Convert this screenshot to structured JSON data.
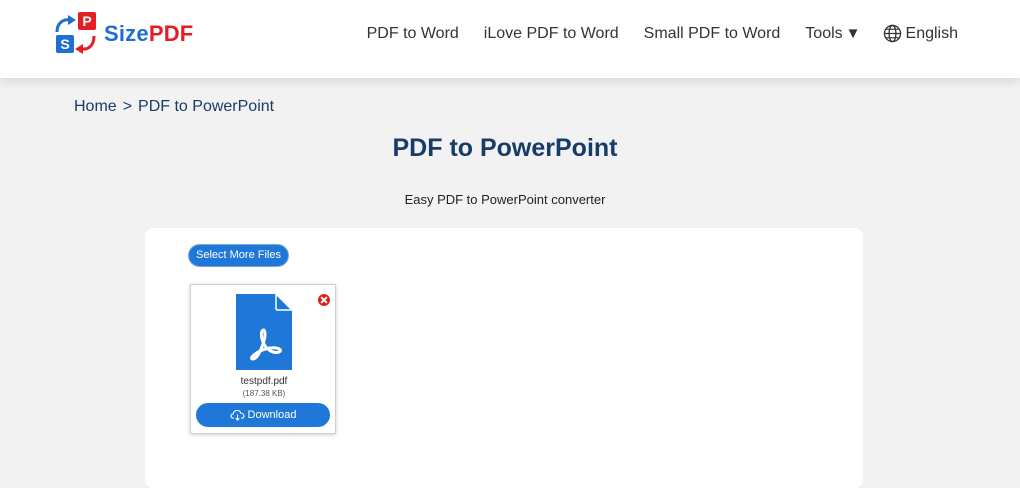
{
  "brand": {
    "name_part1": "Size",
    "name_part2": "PDF",
    "colors": {
      "blue": "#1f6fd1",
      "red": "#e31f26"
    },
    "logo_letters": {
      "top": "P",
      "bottom": "S"
    }
  },
  "nav": {
    "items": [
      {
        "label": "PDF to Word"
      },
      {
        "label": "iLove PDF to Word"
      },
      {
        "label": "Small PDF to Word"
      }
    ],
    "tools_label": "Tools",
    "tools_caret": "▼",
    "language_label": "English",
    "language_icon": "globe-icon"
  },
  "breadcrumb": {
    "home": "Home",
    "separator": ">",
    "current": "PDF to PowerPoint"
  },
  "page": {
    "title": "PDF to PowerPoint",
    "subtitle": "Easy PDF to PowerPoint converter"
  },
  "upload": {
    "select_more_label": "Select More Files",
    "files": [
      {
        "name": "testpdf.pdf",
        "size": "(187.38 KB)",
        "icon": "pdf-file-icon",
        "download_label": "Download",
        "download_icon": "cloud-download-icon",
        "remove_icon": "close-icon"
      }
    ]
  },
  "colors": {
    "accent": "#1f78d8",
    "title": "#173c69",
    "background": "#f2f2f2",
    "remove": "#d9241c"
  }
}
